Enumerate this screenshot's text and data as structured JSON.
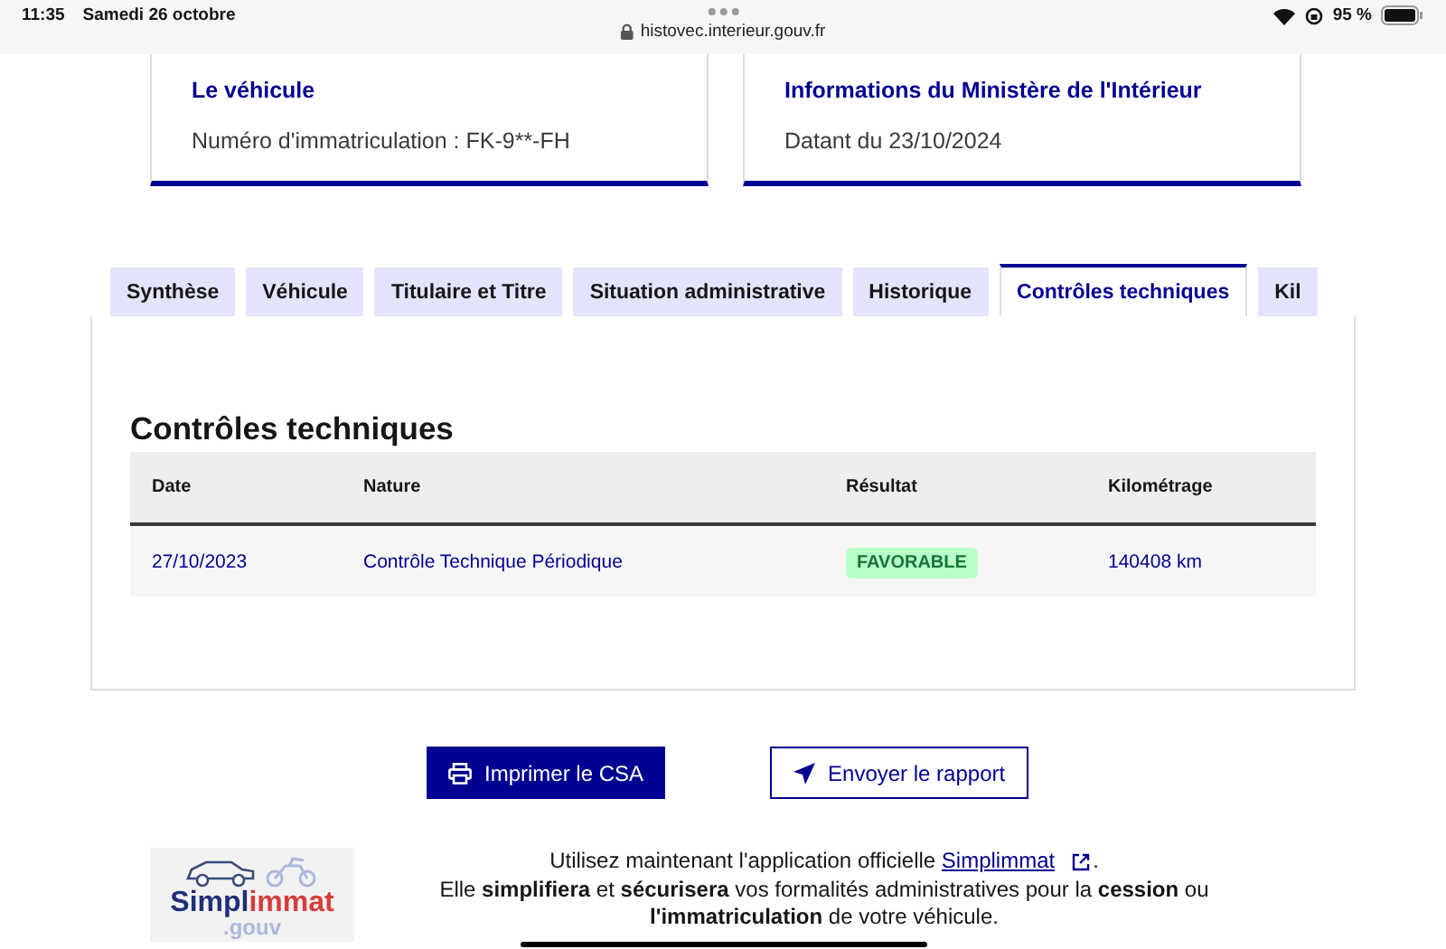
{
  "status_bar": {
    "time": "11:35",
    "date": "Samedi 26 octobre",
    "url": "histovec.interieur.gouv.fr",
    "battery": "95 %"
  },
  "cards": [
    {
      "title": "Le véhicule",
      "text": "Numéro d'immatriculation : FK-9**-FH"
    },
    {
      "title": "Informations du Ministère de l'Intérieur",
      "text": "Datant du 23/10/2024"
    }
  ],
  "tabs": [
    {
      "label": "Synthèse",
      "selected": false
    },
    {
      "label": "Véhicule",
      "selected": false
    },
    {
      "label": "Titulaire et Titre",
      "selected": false
    },
    {
      "label": "Situation administrative",
      "selected": false
    },
    {
      "label": "Historique",
      "selected": false
    },
    {
      "label": "Contrôles techniques",
      "selected": true
    },
    {
      "label": "Kil",
      "selected": false
    }
  ],
  "section_title": "Contrôles techniques",
  "table": {
    "columns": [
      "Date",
      "Nature",
      "Résultat",
      "Kilométrage"
    ],
    "rows": [
      {
        "date": "27/10/2023",
        "nature": "Contrôle Technique Périodique",
        "result": "FAVORABLE",
        "mileage": "140408 km"
      }
    ]
  },
  "buttons": [
    {
      "label": "Imprimer le CSA",
      "kind": "primary"
    },
    {
      "label": "Envoyer le rapport",
      "kind": "secondary"
    }
  ],
  "promo": {
    "logo_name": "Simpl",
    "logo_accent": "immat",
    "logo_suffix": ".gouv",
    "line1": "Utilisez maintenant l'application officielle ",
    "link": "Simplimmat",
    "line1_end": ".",
    "line2": "Elle **simplifiera** et **sécurisera** vos formalités administratives pour la **cession** ou **l'immatriculation** de votre véhicule."
  }
}
